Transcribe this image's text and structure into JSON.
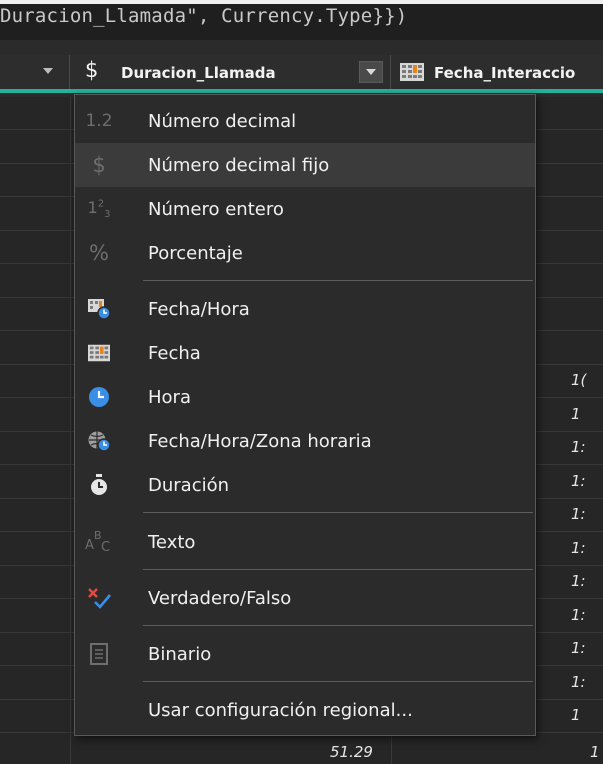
{
  "formula": {
    "text": "Duracion_Llamada\", Currency.Type}})"
  },
  "header": {
    "current_column": {
      "type_icon": "$",
      "name": "Duracion_Llamada"
    },
    "next_column": {
      "name": "Fecha_Interaccio"
    }
  },
  "grid": {
    "last_row_value": "51.29",
    "right_col_partial": [
      "",
      "",
      "",
      "",
      "",
      "",
      "",
      "",
      "1(",
      "1",
      "1:",
      "1:",
      "1:",
      "1:",
      "1:",
      "1:",
      "1:",
      "1:",
      "1"
    ]
  },
  "menu": {
    "items": [
      {
        "label": "Número decimal",
        "icon": "decimal-icon",
        "glyph": "1.2"
      },
      {
        "label": "Número decimal fijo",
        "icon": "fixed-decimal-icon",
        "glyph": "$"
      },
      {
        "label": "Número entero",
        "icon": "whole-number-icon",
        "glyph": "1²₃"
      },
      {
        "label": "Porcentaje",
        "icon": "percent-icon",
        "glyph": "%"
      },
      {
        "label": "Fecha/Hora",
        "icon": "datetime-icon"
      },
      {
        "label": "Fecha",
        "icon": "calendar-icon"
      },
      {
        "label": "Hora",
        "icon": "clock-icon"
      },
      {
        "label": "Fecha/Hora/Zona horaria",
        "icon": "datetime-zone-icon"
      },
      {
        "label": "Duración",
        "icon": "stopwatch-icon"
      },
      {
        "label": "Texto",
        "icon": "text-icon",
        "glyph": "ABC"
      },
      {
        "label": "Verdadero/Falso",
        "icon": "true-false-icon"
      },
      {
        "label": "Binario",
        "icon": "binary-icon"
      },
      {
        "label": "Usar configuración regional...",
        "icon": ""
      }
    ],
    "hovered_index": 1
  },
  "colors": {
    "accent": "#22b39b",
    "menu_bg": "#2b2b2b",
    "hover": "#3b3b3b",
    "orange": "#e8831d",
    "blue": "#3a8ee6"
  }
}
